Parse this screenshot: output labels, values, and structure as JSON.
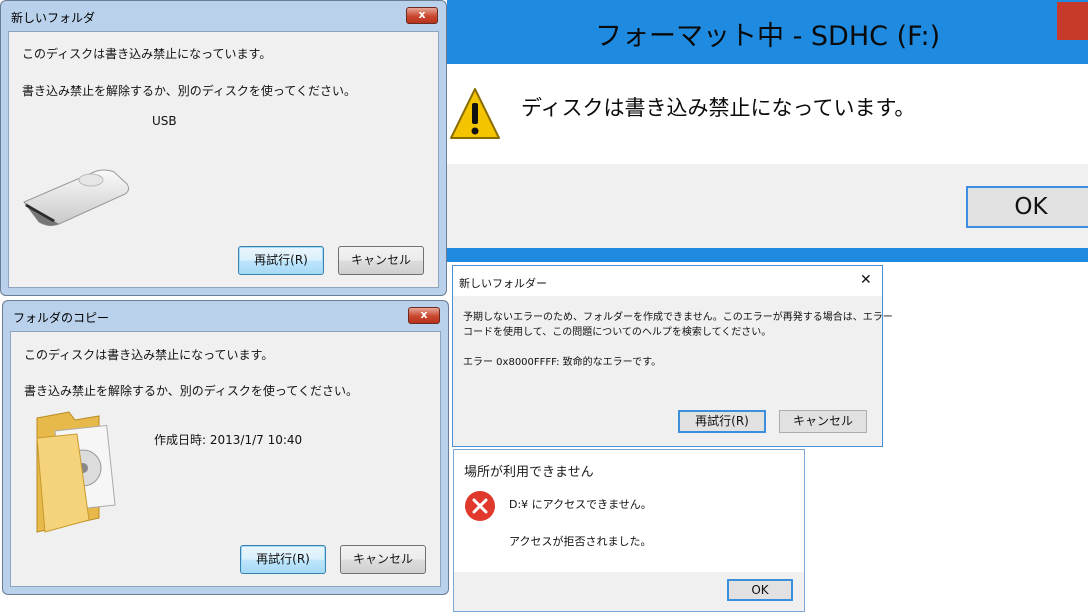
{
  "dialog_new_folder_usb": {
    "title": "新しいフォルダ",
    "close": "x",
    "line1": "このディスクは書き込み禁止になっています。",
    "line2": "書き込み禁止を解除するか、別のディスクを使ってください。",
    "device": "USB",
    "retry": "再試行(R)",
    "cancel": "キャンセル"
  },
  "dialog_copy_folder": {
    "title": "フォルダのコピー",
    "close": "x",
    "line1": "このディスクは書き込み禁止になっています。",
    "line2": "書き込み禁止を解除するか、別のディスクを使ってください。",
    "created": "作成日時: 2013/1/7 10:40",
    "retry": "再試行(R)",
    "cancel": "キャンセル"
  },
  "dialog_format": {
    "title": "フォーマット中 - SDHC (F:)",
    "message": "ディスクは書き込み禁止になっています。",
    "ok": "OK"
  },
  "dialog_new_folder_error": {
    "title": "新しいフォルダー",
    "close": "✕",
    "line1": "予期しないエラーのため、フォルダーを作成できません。このエラーが再発する場合は、エラー",
    "line2": "コードを使用して、この問題についてのヘルプを検索してください。",
    "error_code": "エラー 0x8000FFFF: 致命的なエラーです。",
    "retry": "再試行(R)",
    "cancel": "キャンセル"
  },
  "dialog_location": {
    "title": "場所が利用できません",
    "line1": "D:¥ にアクセスできません。",
    "line2": "アクセスが拒否されました。",
    "ok": "OK"
  },
  "colors": {
    "win8_accent": "#1f8be0",
    "error_red": "#e0392b",
    "warning_yellow": "#f5c400"
  }
}
